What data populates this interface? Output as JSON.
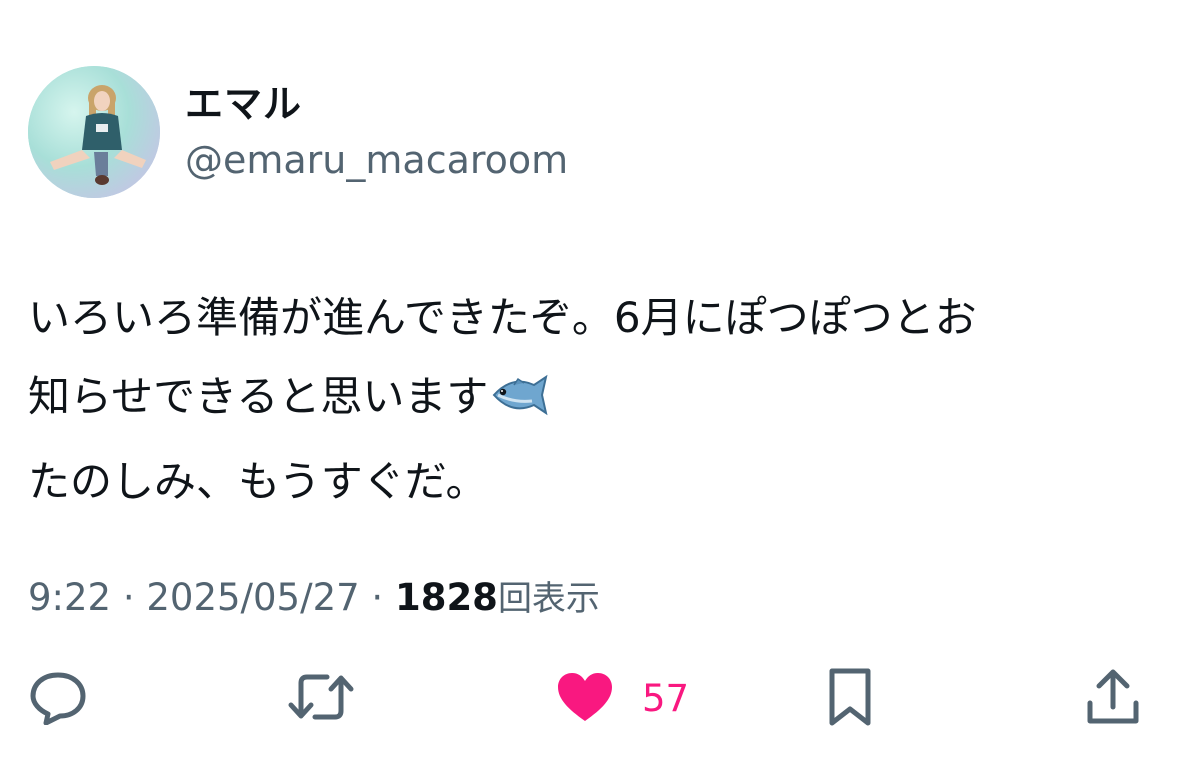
{
  "author": {
    "display_name": "エマル",
    "handle": "@emaru_macaroom"
  },
  "tweet": {
    "lines": [
      "いろいろ準備が進んできたぞ。6月にぽつぽつとお",
      "知らせできると思います",
      "たのしみ、もうすぐだ。"
    ],
    "emoji": "fish-emoji"
  },
  "meta": {
    "time": "9:22",
    "separator": " · ",
    "date": "2025/05/27",
    "views_count": "1828",
    "views_label": "回表示"
  },
  "actions": {
    "reply_icon": "reply-icon",
    "retweet_icon": "retweet-icon",
    "like_icon": "heart-icon",
    "like_count": "57",
    "bookmark_icon": "bookmark-icon",
    "share_icon": "share-icon"
  },
  "colors": {
    "text_primary": "#0f1419",
    "text_secondary": "#536471",
    "like": "#f91880"
  }
}
